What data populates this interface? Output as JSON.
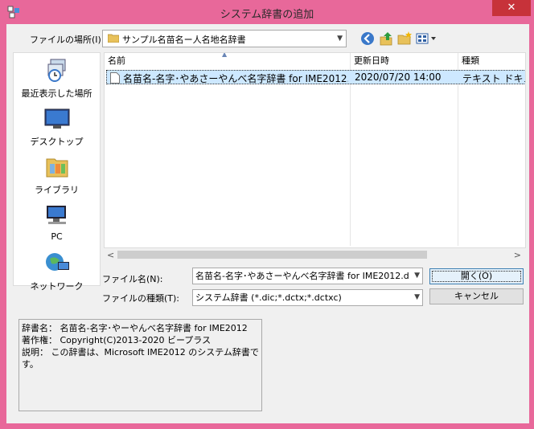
{
  "window": {
    "title": "システム辞書の追加",
    "close_label": "✕"
  },
  "lookin": {
    "label": "ファイルの場所(I):",
    "value": "サンプル名苗名ー人名地名辞書"
  },
  "toolbar": {
    "icons": [
      "back-icon",
      "up-folder-icon",
      "new-folder-icon",
      "view-menu-icon"
    ]
  },
  "places": [
    {
      "label": "最近表示した場所",
      "icon": "recent-places-icon"
    },
    {
      "label": "デスクトップ",
      "icon": "desktop-icon"
    },
    {
      "label": "ライブラリ",
      "icon": "library-icon"
    },
    {
      "label": "PC",
      "icon": "pc-icon"
    },
    {
      "label": "ネットワーク",
      "icon": "network-icon"
    }
  ],
  "columns": {
    "name": "名前",
    "modified": "更新日時",
    "type": "種類"
  },
  "files": [
    {
      "name": "名苗名-名字･やあさーやんべ名字辞書 for IME2012...",
      "modified": "2020/07/20 14:00",
      "type": "テキスト ドキュメ"
    }
  ],
  "filename": {
    "label": "ファイル名(N):",
    "value": "名苗名-名字･やあさーやんべ名字辞書 for IME2012.d"
  },
  "filetype": {
    "label": "ファイルの種類(T):",
    "value": "システム辞書 (*.dic;*.dctx;*.dctxc)"
  },
  "buttons": {
    "open": "開く(O)",
    "cancel": "キャンセル"
  },
  "description": {
    "line1": "辞書名： 名苗名-名字･やーやんべ名字辞書 for IME2012",
    "line2": "著作権： Copyright(C)2013-2020 ビープラス",
    "line3": "説明： この辞書は、Microsoft IME2012 のシステム辞書です。"
  }
}
